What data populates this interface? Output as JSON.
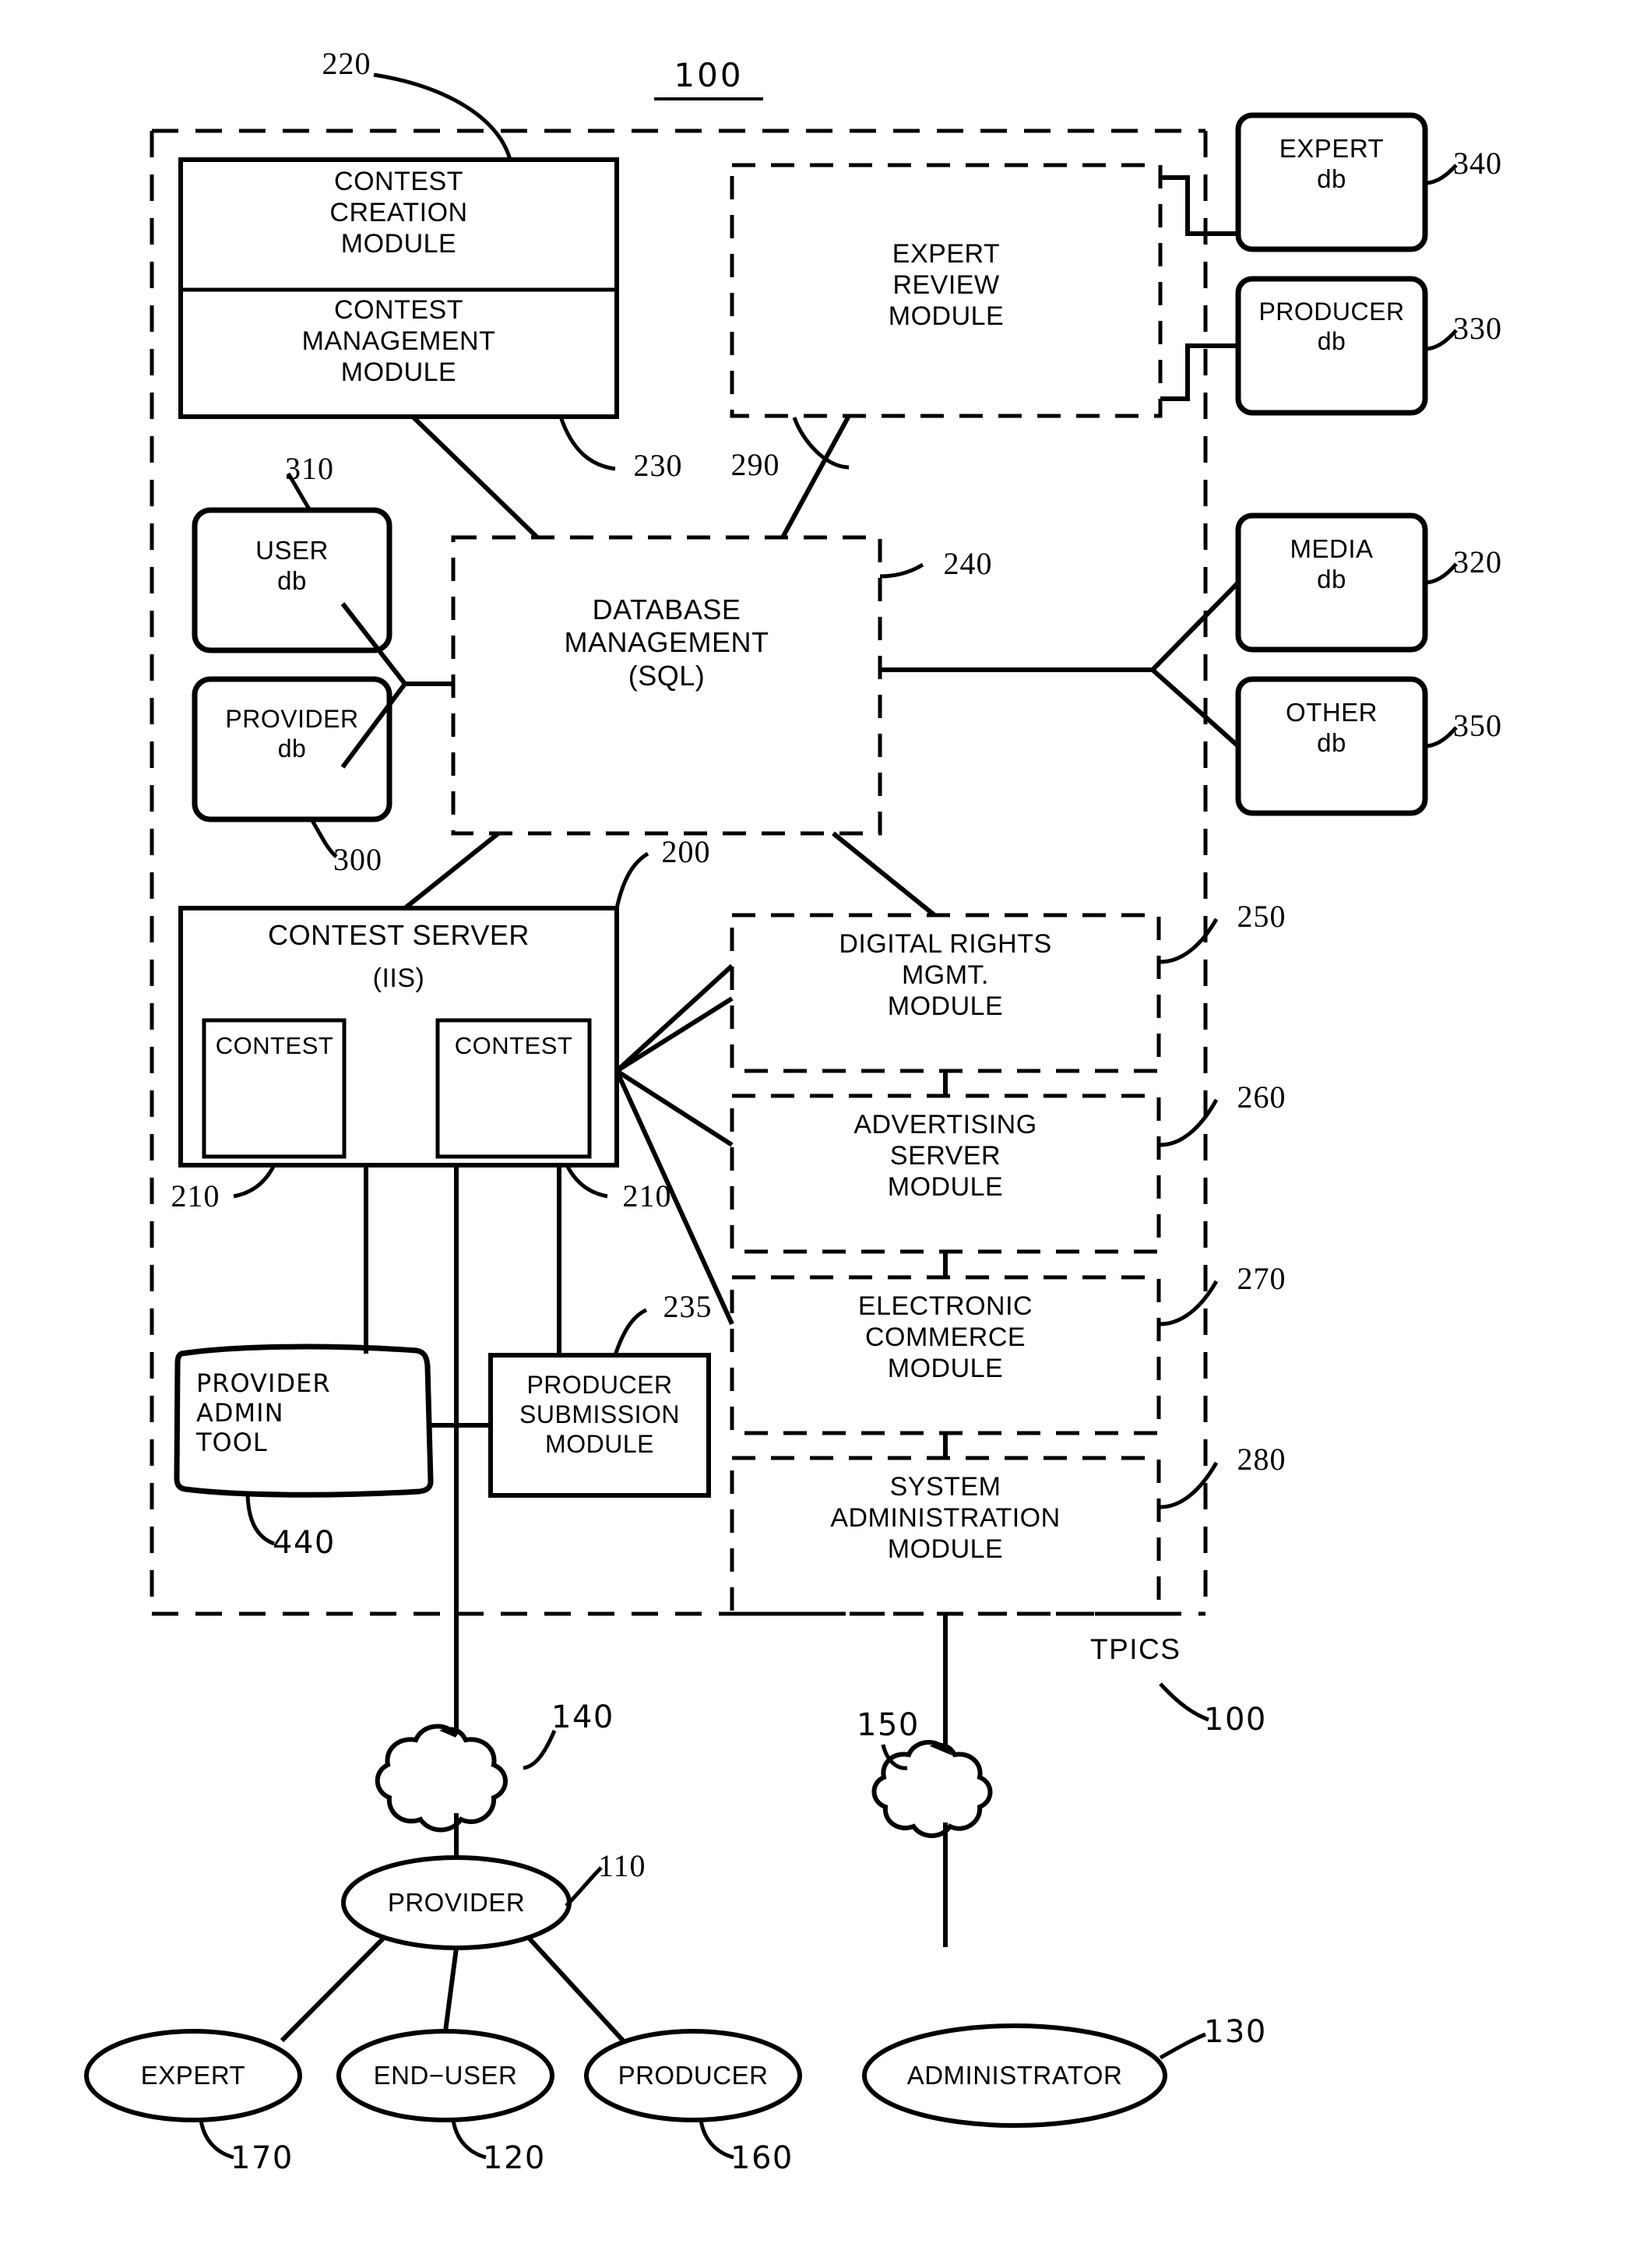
{
  "figure": {
    "title": "100",
    "system_label": "TPICS",
    "system_ref": "100"
  },
  "modules": {
    "contest_creation": {
      "label": "CONTEST\nCREATION\nMODULE",
      "ref": "220"
    },
    "contest_management": {
      "label": "CONTEST\nMANAGEMENT\nMODULE",
      "ref": "230"
    },
    "expert_review": {
      "label": "EXPERT\nREVIEW\nMODULE",
      "ref": "290"
    },
    "database_management": {
      "label": "DATABASE\nMANAGEMENT\n(SQL)",
      "ref": "240"
    },
    "contest_server": {
      "label": "CONTEST SERVER",
      "sublabel": "(IIS)",
      "ref": "200"
    },
    "contest_instance_left": {
      "label": "CONTEST",
      "ref": "210"
    },
    "contest_instance_right": {
      "label": "CONTEST",
      "ref": "210"
    },
    "digital_rights": {
      "label": "DIGITAL RIGHTS\nMGMT.\nMODULE",
      "ref": "250"
    },
    "advertising_server": {
      "label": "ADVERTISING\nSERVER\nMODULE",
      "ref": "260"
    },
    "electronic_commerce": {
      "label": "ELECTRONIC\nCOMMERCE\nMODULE",
      "ref": "270"
    },
    "system_administration": {
      "label": "SYSTEM\nADMINISTRATION\nMODULE",
      "ref": "280"
    },
    "producer_submission": {
      "label": "PRODUCER\nSUBMISSION\nMODULE",
      "ref": "235"
    },
    "provider_admin_tool": {
      "label": "PROVIDER\nADMIN\nTOOL",
      "ref": "440"
    }
  },
  "databases": {
    "expert": {
      "label": "EXPERT\ndb",
      "ref": "340"
    },
    "producer": {
      "label": "PRODUCER\ndb",
      "ref": "330"
    },
    "media": {
      "label": "MEDIA\ndb",
      "ref": "320"
    },
    "other": {
      "label": "OTHER\ndb",
      "ref": "350"
    },
    "user": {
      "label": "USER\ndb",
      "ref": "310"
    },
    "provider": {
      "label": "PROVIDER\ndb",
      "ref": "300"
    }
  },
  "networks": {
    "provider_network": {
      "ref": "140"
    },
    "admin_network": {
      "ref": "150"
    }
  },
  "actors": {
    "provider": {
      "label": "PROVIDER",
      "ref": "110"
    },
    "expert": {
      "label": "EXPERT",
      "ref": "170"
    },
    "end_user": {
      "label": "END−USER",
      "ref": "120"
    },
    "producer": {
      "label": "PRODUCER",
      "ref": "160"
    },
    "administrator": {
      "label": "ADMINISTRATOR",
      "ref": "130"
    }
  }
}
